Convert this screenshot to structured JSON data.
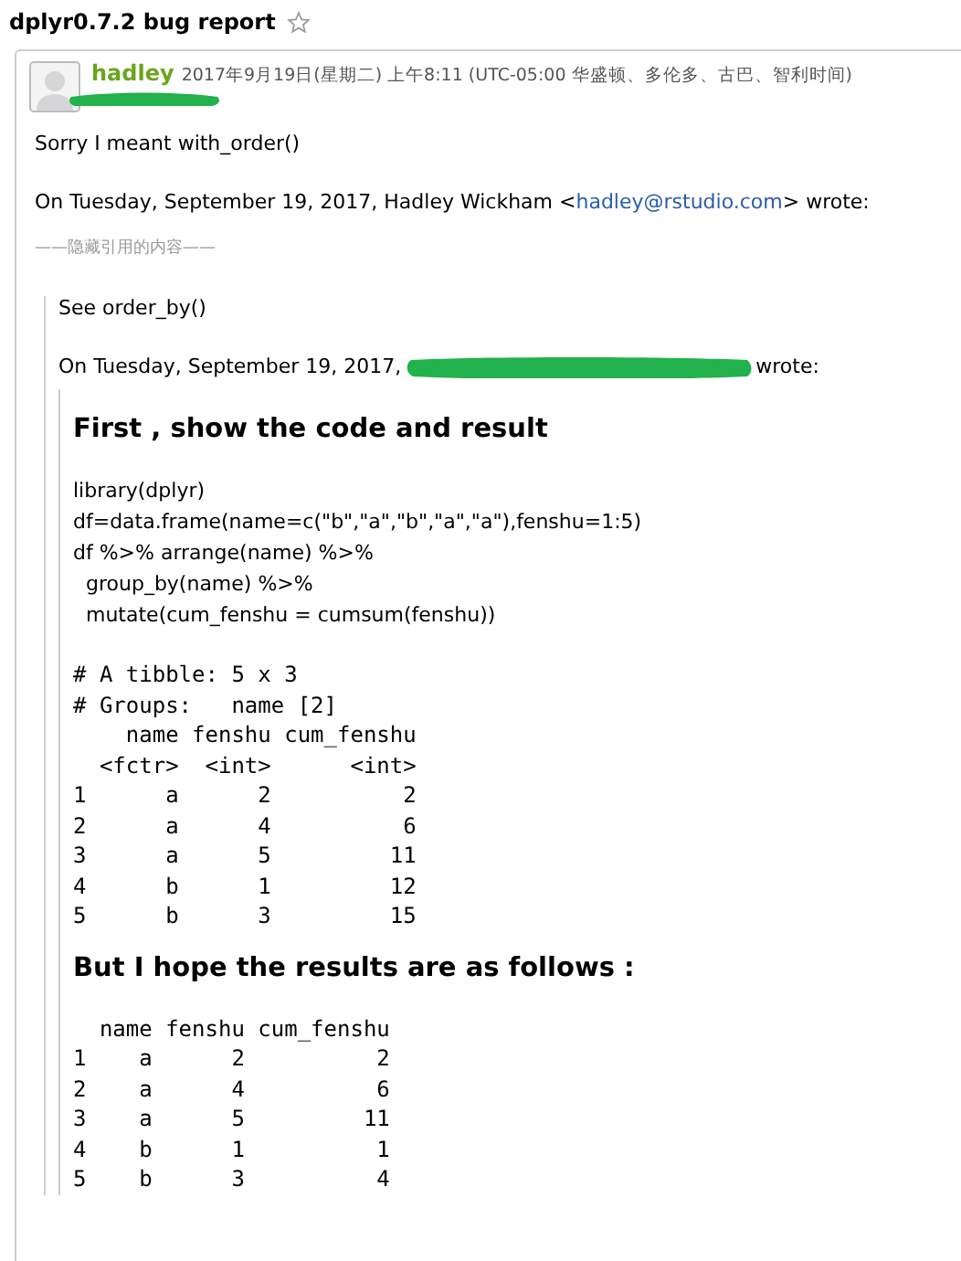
{
  "subject": "dplyr0.7.2 bug report",
  "starred": false,
  "message": {
    "sender": "hadley",
    "date": "2017年9月19日(星期二) 上午8:11 (UTC-05:00 华盛顿、多伦多、古巴、智利时间)",
    "reply": "Sorry I meant with_order()",
    "attribution_prefix": "On Tuesday, September 19, 2017, Hadley Wickham <",
    "attribution_link": "hadley@rstudio.com",
    "attribution_suffix": "> wrote:",
    "hidden_quote": "——隐藏引用的内容——",
    "quote": {
      "text": "See order_by()",
      "attribution_prefix": "On Tuesday, September 19, 2017,",
      "attribution_suffix": "wrote:",
      "inner": {
        "heading1": "First , show the code and result",
        "code": [
          "library(dplyr)",
          "df=data.frame(name=c(\"b\",\"a\",\"b\",\"a\",\"a\"),fenshu=1:5)",
          "df %>% arrange(name) %>%",
          "  group_by(name) %>%",
          "  mutate(cum_fenshu = cumsum(fenshu))"
        ],
        "output": [
          "# A tibble: 5 x 3",
          "# Groups:   name [2]",
          "    name fenshu cum_fenshu",
          "  <fctr>  <int>      <int>",
          "1      a      2          2",
          "2      a      4          6",
          "3      a      5         11",
          "4      b      1         12",
          "5      b      3         15"
        ],
        "heading2": "But I hope the results are as follows :",
        "expected": [
          "  name fenshu cum_fenshu",
          "1    a      2          2",
          "2    a      4          6",
          "3    a      5         11",
          "4    b      1          1",
          "5    b      3          4"
        ]
      }
    }
  }
}
